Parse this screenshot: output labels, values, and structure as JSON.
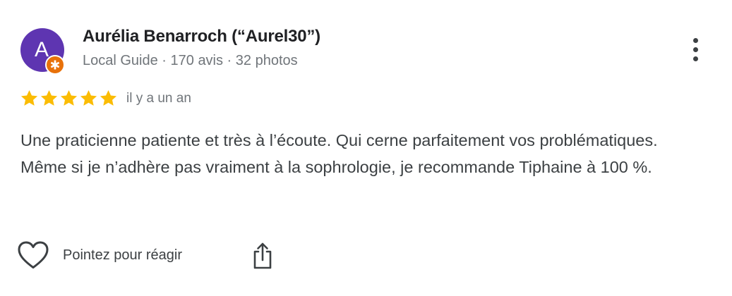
{
  "reviewer": {
    "avatar_letter": "A",
    "avatar_color": "#5e35b1",
    "badge_icon": "local-guide-badge-icon",
    "badge_color": "#e8710a",
    "name": "Aurélia Benarroch (“Aurel30”)",
    "meta": "Local Guide · 170 avis · 32 photos"
  },
  "review": {
    "rating": 5,
    "max_rating": 5,
    "star_color": "#fbbc04",
    "time": "il y a un an",
    "text": "Une praticienne patiente et très à l’écoute. Qui cerne parfaitement vos problématiques. Même si je n’adhère pas vraiment à la sophrologie, je recommande Tiphaine à 100 %."
  },
  "actions": {
    "more_icon": "more-vert-icon",
    "react_icon": "heart-outline-icon",
    "react_label": "Pointez pour réagir",
    "share_icon": "share-icon"
  }
}
